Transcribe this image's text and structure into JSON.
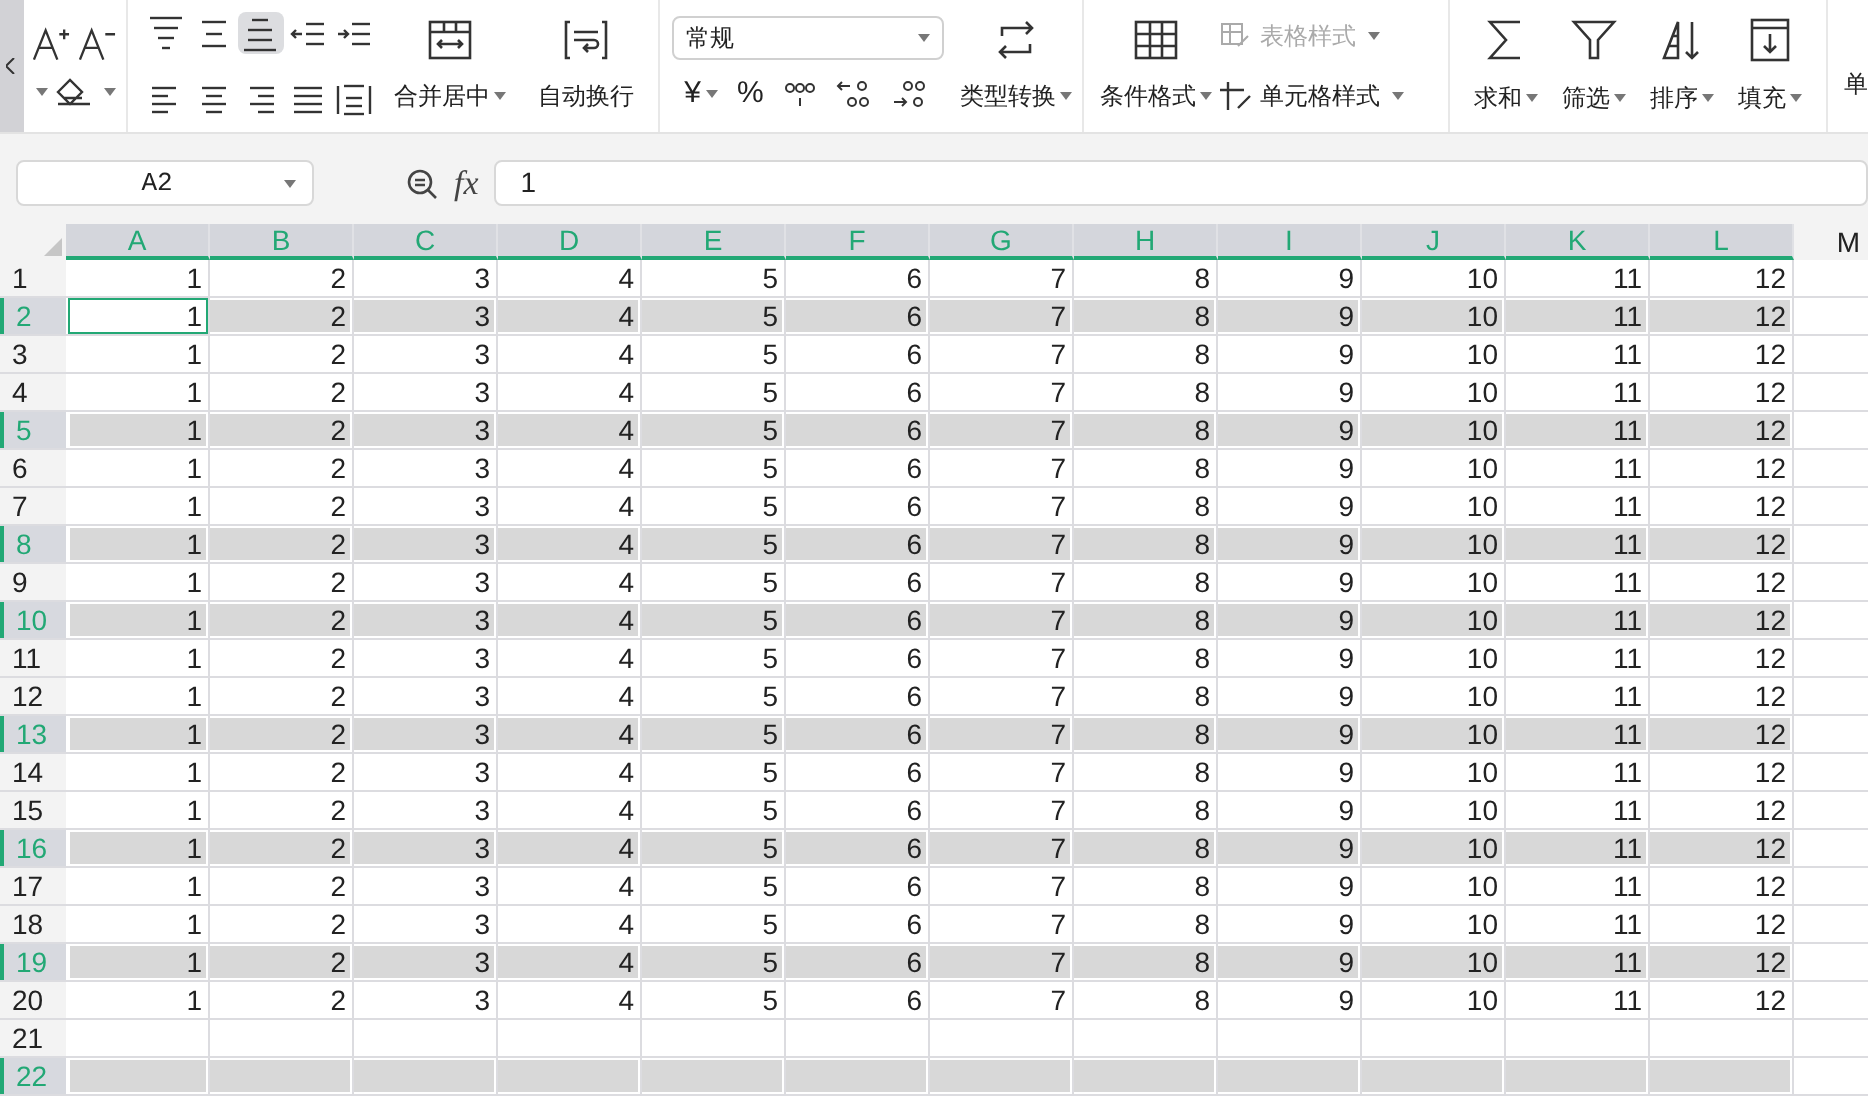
{
  "ribbon": {
    "alignment_buttons": [
      {
        "kind": "top",
        "selected": false
      },
      {
        "kind": "middle",
        "selected": false
      },
      {
        "kind": "bottom",
        "selected": true
      },
      {
        "kind": "outdent",
        "selected": false
      },
      {
        "kind": "indent",
        "selected": false
      },
      {
        "kind": "left",
        "selected": false
      },
      {
        "kind": "center",
        "selected": false
      },
      {
        "kind": "right",
        "selected": false
      },
      {
        "kind": "justify",
        "selected": false
      },
      {
        "kind": "distributed",
        "selected": false
      }
    ],
    "merge_center": "合并居中",
    "wrap_text": "自动换行",
    "number_format": "常规",
    "currency": "¥",
    "percent": "%",
    "type_convert": "类型转换",
    "conditional_format": "条件格式",
    "table_style": {
      "label": "表格样式",
      "disabled": true
    },
    "cell_style": "单元格样式",
    "tools": [
      {
        "kind": "sum",
        "label": "求和"
      },
      {
        "kind": "filter",
        "label": "筛选"
      },
      {
        "kind": "sort",
        "label": "排序"
      },
      {
        "kind": "fill",
        "label": "填充"
      }
    ],
    "cut_label": "单"
  },
  "formula_bar": {
    "name_box": "A2",
    "fx": "fx",
    "value": "1"
  },
  "columns": [
    {
      "label": "A",
      "selected": true
    },
    {
      "label": "B",
      "selected": true
    },
    {
      "label": "C",
      "selected": true
    },
    {
      "label": "D",
      "selected": true
    },
    {
      "label": "E",
      "selected": true
    },
    {
      "label": "F",
      "selected": true
    },
    {
      "label": "G",
      "selected": true
    },
    {
      "label": "H",
      "selected": true
    },
    {
      "label": "I",
      "selected": true
    },
    {
      "label": "J",
      "selected": true
    },
    {
      "label": "K",
      "selected": true
    },
    {
      "label": "L",
      "selected": true
    },
    {
      "label": "M",
      "selected": false
    }
  ],
  "rows": [
    {
      "header": "1",
      "selected": false,
      "cells": [
        "1",
        "2",
        "3",
        "4",
        "5",
        "6",
        "7",
        "8",
        "9",
        "10",
        "11",
        "12"
      ]
    },
    {
      "header": "2",
      "selected": true,
      "cells": [
        {
          "value": "1",
          "active": true
        },
        "2",
        "3",
        "4",
        "5",
        "6",
        "7",
        "8",
        "9",
        "10",
        "11",
        "12"
      ]
    },
    {
      "header": "3",
      "selected": false,
      "cells": [
        "1",
        "2",
        "3",
        "4",
        "5",
        "6",
        "7",
        "8",
        "9",
        "10",
        "11",
        "12"
      ]
    },
    {
      "header": "4",
      "selected": false,
      "cells": [
        "1",
        "2",
        "3",
        "4",
        "5",
        "6",
        "7",
        "8",
        "9",
        "10",
        "11",
        "12"
      ]
    },
    {
      "header": "5",
      "selected": true,
      "cells": [
        "1",
        "2",
        "3",
        "4",
        "5",
        "6",
        "7",
        "8",
        "9",
        "10",
        "11",
        "12"
      ]
    },
    {
      "header": "6",
      "selected": false,
      "cells": [
        "1",
        "2",
        "3",
        "4",
        "5",
        "6",
        "7",
        "8",
        "9",
        "10",
        "11",
        "12"
      ]
    },
    {
      "header": "7",
      "selected": false,
      "cells": [
        "1",
        "2",
        "3",
        "4",
        "5",
        "6",
        "7",
        "8",
        "9",
        "10",
        "11",
        "12"
      ]
    },
    {
      "header": "8",
      "selected": true,
      "cells": [
        "1",
        "2",
        "3",
        "4",
        "5",
        "6",
        "7",
        "8",
        "9",
        "10",
        "11",
        "12"
      ]
    },
    {
      "header": "9",
      "selected": false,
      "cells": [
        "1",
        "2",
        "3",
        "4",
        "5",
        "6",
        "7",
        "8",
        "9",
        "10",
        "11",
        "12"
      ]
    },
    {
      "header": "10",
      "selected": true,
      "cells": [
        "1",
        "2",
        "3",
        "4",
        "5",
        "6",
        "7",
        "8",
        "9",
        "10",
        "11",
        "12"
      ]
    },
    {
      "header": "11",
      "selected": false,
      "cells": [
        "1",
        "2",
        "3",
        "4",
        "5",
        "6",
        "7",
        "8",
        "9",
        "10",
        "11",
        "12"
      ]
    },
    {
      "header": "12",
      "selected": false,
      "cells": [
        "1",
        "2",
        "3",
        "4",
        "5",
        "6",
        "7",
        "8",
        "9",
        "10",
        "11",
        "12"
      ]
    },
    {
      "header": "13",
      "selected": true,
      "cells": [
        "1",
        "2",
        "3",
        "4",
        "5",
        "6",
        "7",
        "8",
        "9",
        "10",
        "11",
        "12"
      ]
    },
    {
      "header": "14",
      "selected": false,
      "cells": [
        "1",
        "2",
        "3",
        "4",
        "5",
        "6",
        "7",
        "8",
        "9",
        "10",
        "11",
        "12"
      ]
    },
    {
      "header": "15",
      "selected": false,
      "cells": [
        "1",
        "2",
        "3",
        "4",
        "5",
        "6",
        "7",
        "8",
        "9",
        "10",
        "11",
        "12"
      ]
    },
    {
      "header": "16",
      "selected": true,
      "cells": [
        "1",
        "2",
        "3",
        "4",
        "5",
        "6",
        "7",
        "8",
        "9",
        "10",
        "11",
        "12"
      ]
    },
    {
      "header": "17",
      "selected": false,
      "cells": [
        "1",
        "2",
        "3",
        "4",
        "5",
        "6",
        "7",
        "8",
        "9",
        "10",
        "11",
        "12"
      ]
    },
    {
      "header": "18",
      "selected": false,
      "cells": [
        "1",
        "2",
        "3",
        "4",
        "5",
        "6",
        "7",
        "8",
        "9",
        "10",
        "11",
        "12"
      ]
    },
    {
      "header": "19",
      "selected": true,
      "cells": [
        "1",
        "2",
        "3",
        "4",
        "5",
        "6",
        "7",
        "8",
        "9",
        "10",
        "11",
        "12"
      ]
    },
    {
      "header": "20",
      "selected": false,
      "cells": [
        "1",
        "2",
        "3",
        "4",
        "5",
        "6",
        "7",
        "8",
        "9",
        "10",
        "11",
        "12"
      ]
    },
    {
      "header": "21",
      "selected": false,
      "cells": []
    },
    {
      "header": "22",
      "selected": true,
      "cells": []
    }
  ]
}
